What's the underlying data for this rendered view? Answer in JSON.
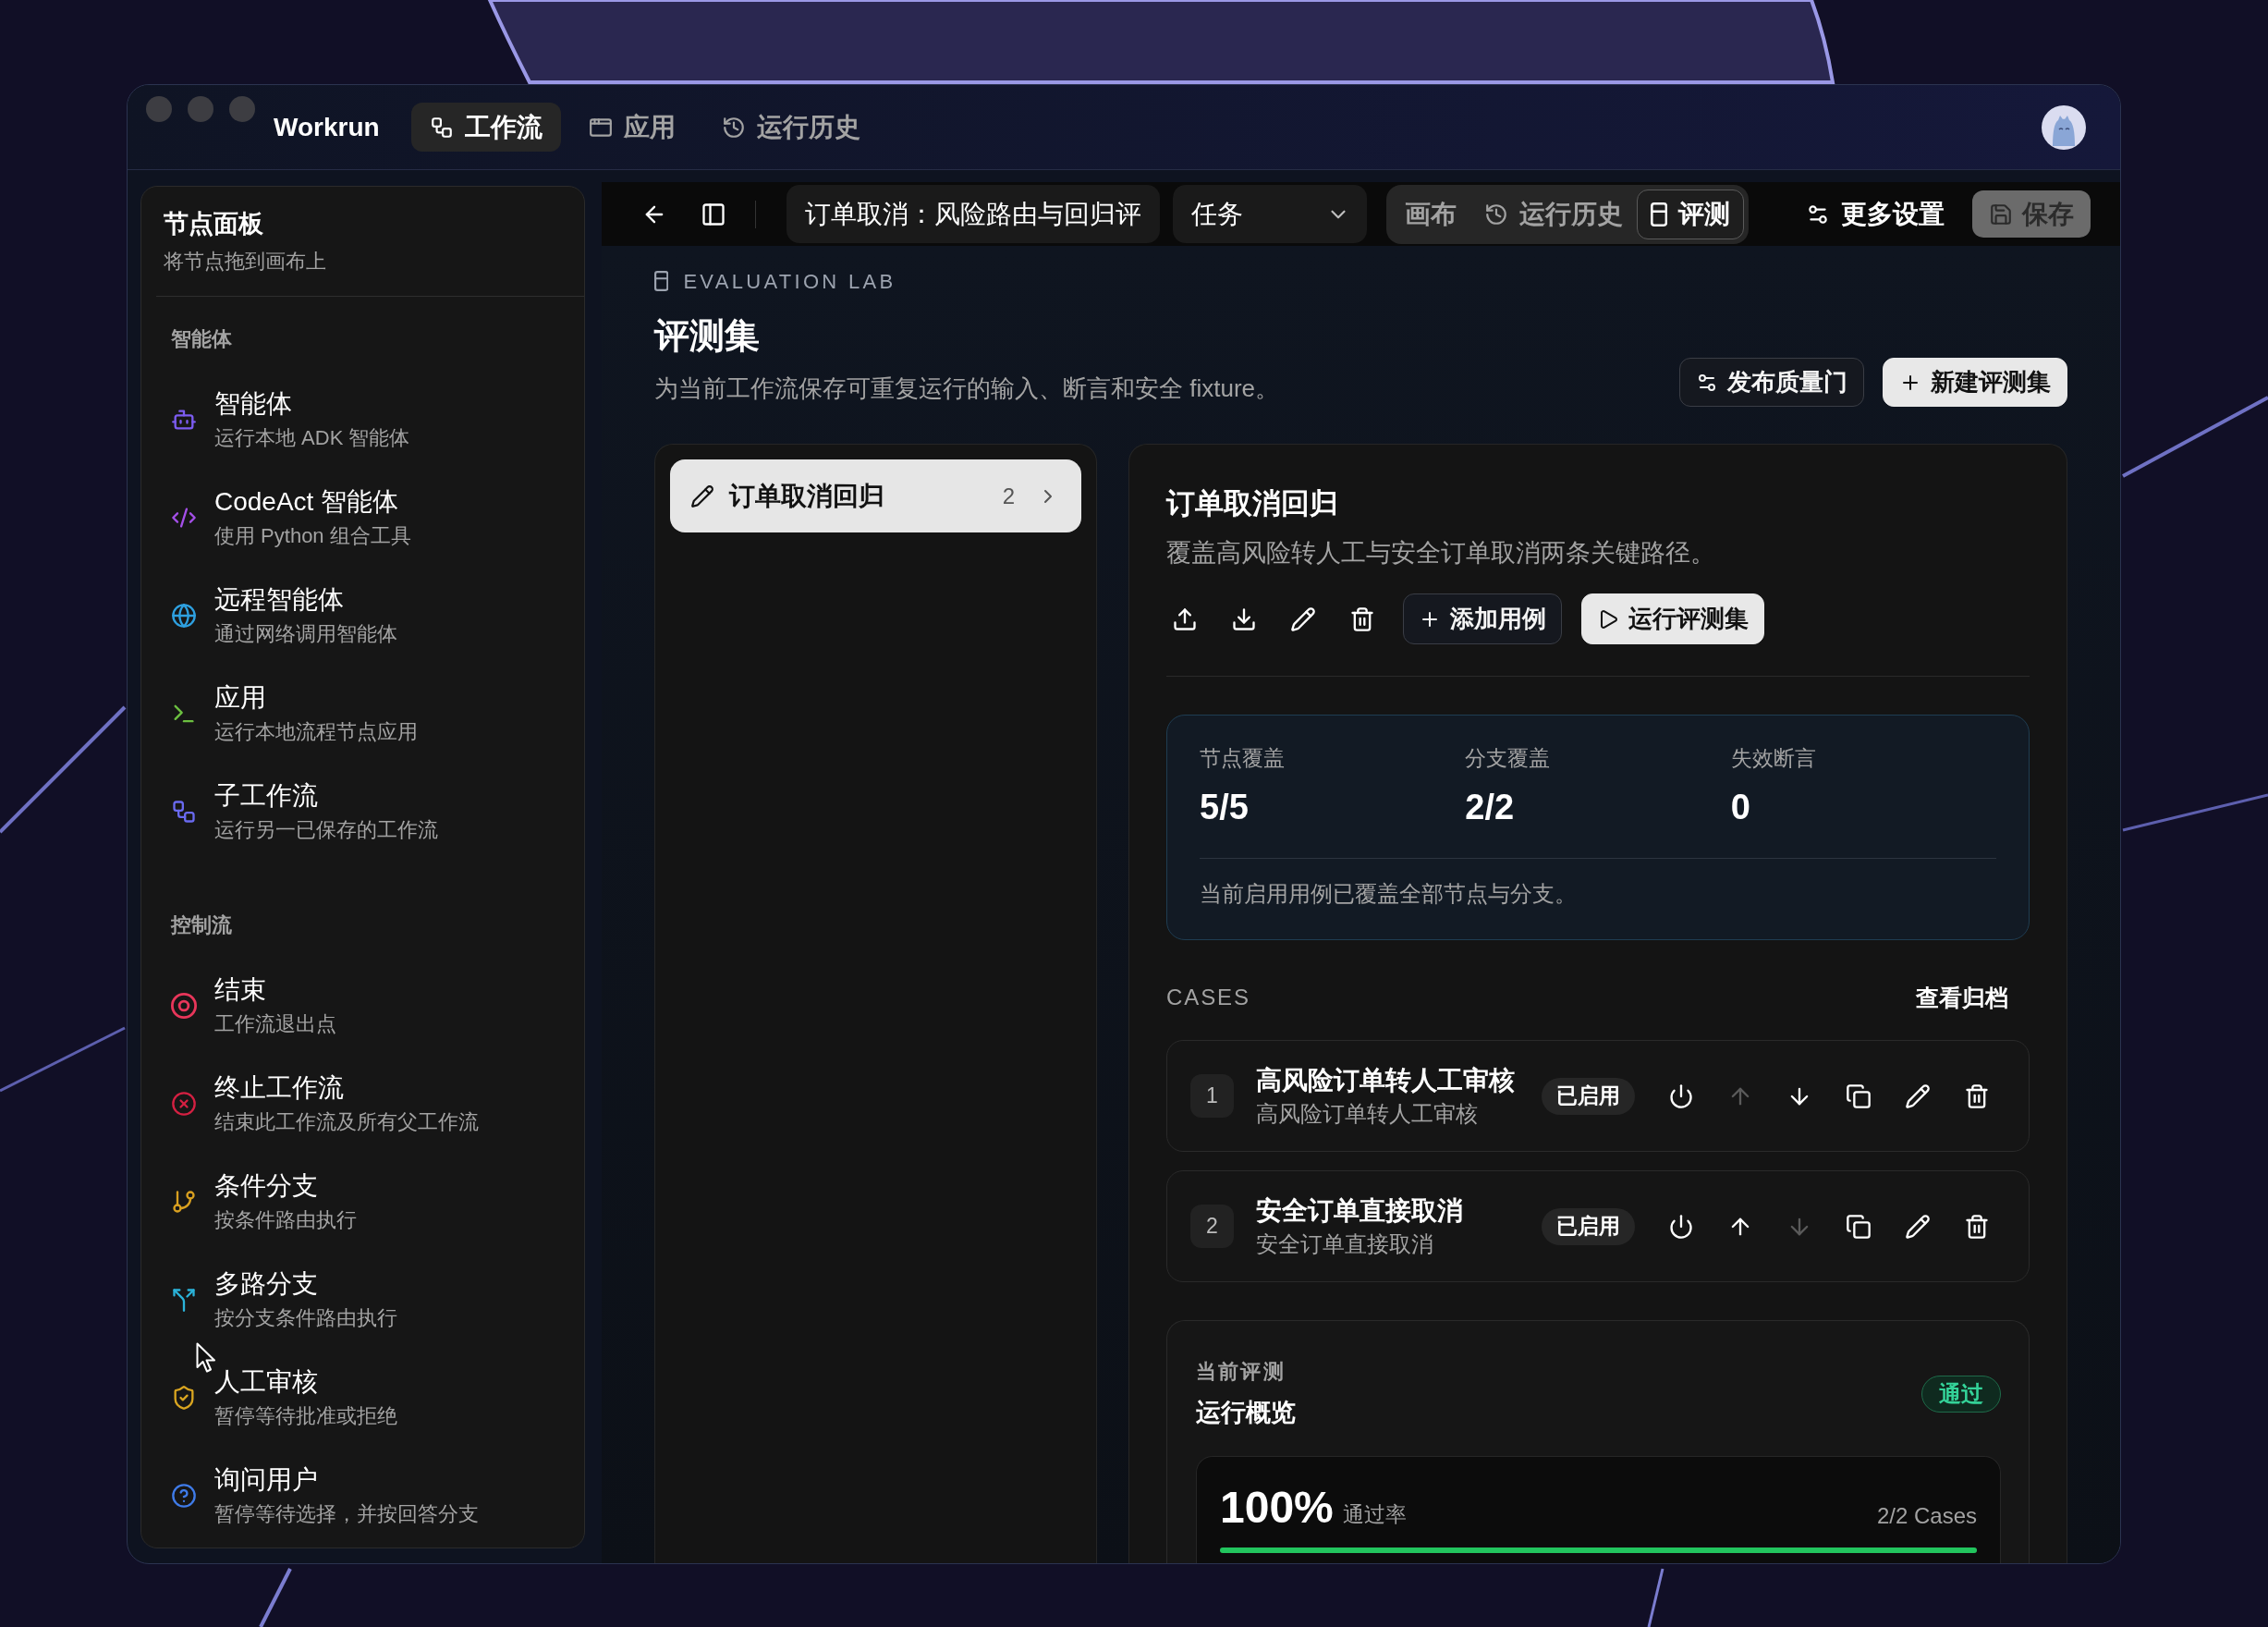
{
  "window": {
    "app_name": "Workrun",
    "nav_tabs": [
      {
        "label": "工作流",
        "selected": true
      },
      {
        "label": "应用",
        "selected": false
      },
      {
        "label": "运行历史",
        "selected": false
      }
    ]
  },
  "palette": {
    "title": "节点面板",
    "subtitle": "将节点拖到画布上",
    "sections": [
      {
        "label": "智能体",
        "items": [
          {
            "kind": "agent",
            "title": "智能体",
            "description": "运行本地 ADK 智能体",
            "color": "#7c5cf0"
          },
          {
            "kind": "code",
            "title": "CodeAct 智能体",
            "description": "使用 Python 组合工具",
            "color": "#a44fe8"
          },
          {
            "kind": "remote",
            "title": "远程智能体",
            "description": "通过网络调用智能体",
            "color": "#2ea0e0"
          },
          {
            "kind": "app",
            "title": "应用",
            "description": "运行本地流程节点应用",
            "color": "#6cc040"
          },
          {
            "kind": "subflow",
            "title": "子工作流",
            "description": "运行另一已保存的工作流",
            "color": "#6a6af0"
          }
        ]
      },
      {
        "label": "控制流",
        "items": [
          {
            "kind": "end",
            "title": "结束",
            "description": "工作流退出点",
            "color": "#e8365a"
          },
          {
            "kind": "terminate",
            "title": "终止工作流",
            "description": "结束此工作流及所有父工作流",
            "color": "#d42042"
          },
          {
            "kind": "branch",
            "title": "条件分支",
            "description": "按条件路由执行",
            "color": "#d9a020"
          },
          {
            "kind": "switch",
            "title": "多路分支",
            "description": "按分支条件路由执行",
            "color": "#2bb3d9"
          },
          {
            "kind": "approval",
            "title": "人工审核",
            "description": "暂停等待批准或拒绝",
            "color": "#d9a520"
          },
          {
            "kind": "ask",
            "title": "询问用户",
            "description": "暂停等待选择，并按回答分支",
            "color": "#3f7be8"
          }
        ]
      }
    ]
  },
  "toolbar": {
    "workflow_name": "订单取消：风险路由与回归评",
    "mode": "任务",
    "views": [
      {
        "label": "画布",
        "selected": false
      },
      {
        "label": "运行历史",
        "selected": false
      },
      {
        "label": "评测",
        "selected": true
      }
    ],
    "more_settings": "更多设置",
    "save": {
      "label": "保存",
      "disabled": true
    }
  },
  "header": {
    "eyebrow": "EVALUATION LAB",
    "title": "评测集",
    "description": "为当前工作流保存可重复运行的输入、断言和安全 fixture。",
    "actions": [
      {
        "kind": "outline",
        "label": "发布质量门"
      },
      {
        "kind": "primary",
        "label": "新建评测集"
      }
    ]
  },
  "eval_sets": [
    {
      "name": "订单取消回归",
      "count": "2",
      "selected": true
    }
  ],
  "detail": {
    "title": "订单取消回归",
    "description": "覆盖高风险转人工与安全订单取消两条关键路径。",
    "actions": [
      {
        "kind": "outline",
        "label": "添加用例"
      },
      {
        "kind": "primary",
        "label": "运行评测集"
      }
    ],
    "coverage": {
      "stats": [
        {
          "label": "节点覆盖",
          "value": "5/5"
        },
        {
          "label": "分支覆盖",
          "value": "2/2"
        },
        {
          "label": "失效断言",
          "value": "0"
        }
      ],
      "note": "当前启用用例已覆盖全部节点与分支。"
    },
    "cases_heading": "CASES",
    "archive_link": "查看归档",
    "cases": [
      {
        "number": "1",
        "title": "高风险订单转人工审核",
        "subtitle": "高风险订单转人工审核",
        "status": "已启用",
        "up_disabled": true,
        "down_disabled": false
      },
      {
        "number": "2",
        "title": "安全订单直接取消",
        "subtitle": "安全订单直接取消",
        "status": "已启用",
        "up_disabled": false,
        "down_disabled": true
      }
    ],
    "run_summary": {
      "eyebrow": "当前评测",
      "title": "运行概览",
      "result": "通过",
      "pass_rate": "100%",
      "pass_rate_label": "通过率",
      "cases_count": "2/2 Cases",
      "level": 1
    }
  }
}
